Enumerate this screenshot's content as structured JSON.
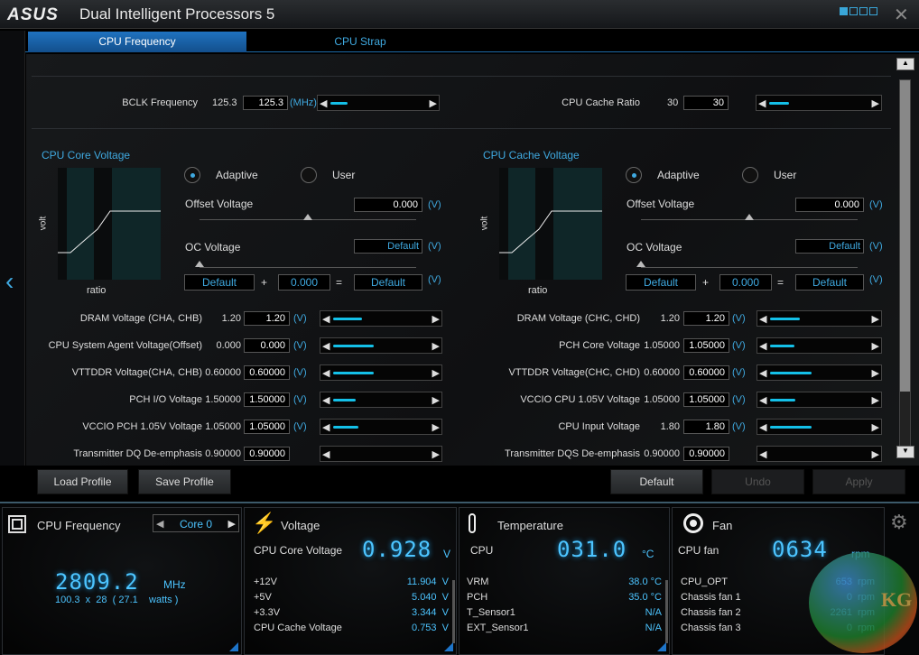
{
  "window": {
    "logo": "ASUS",
    "title": "Dual Intelligent Processors 5",
    "close": "✕"
  },
  "tabs": [
    {
      "label": "CPU Frequency",
      "active": true
    },
    {
      "label": "CPU Strap",
      "active": false
    }
  ],
  "top_row": {
    "bclk": {
      "label": "BCLK Frequency",
      "default": "125.3",
      "value": "125.3",
      "unit": "(MHz)",
      "fill": 0.18
    },
    "cache_ratio": {
      "label": "CPU Cache Ratio",
      "default": "30",
      "value": "30",
      "fill": 0.2
    }
  },
  "core_voltage": {
    "title": "CPU Core Voltage",
    "mode_adaptive": "Adaptive",
    "mode_user": "User",
    "selected": "Adaptive",
    "offset_label": "Offset Voltage",
    "offset_value": "0.000",
    "unit": "(V)",
    "oc_label": "OC Voltage",
    "oc_value": "Default",
    "sum_a": "Default",
    "plus": "+",
    "sum_b": "0.000",
    "equals": "=",
    "sum_result": "Default",
    "graph_ylabel": "volt",
    "graph_xlabel": "ratio",
    "offset_slider": 0.5,
    "oc_slider": 0.0
  },
  "cache_voltage": {
    "title": "CPU Cache Voltage",
    "mode_adaptive": "Adaptive",
    "mode_user": "User",
    "selected": "Adaptive",
    "offset_label": "Offset Voltage",
    "offset_value": "0.000",
    "unit": "(V)",
    "oc_label": "OC Voltage",
    "oc_value": "Default",
    "sum_a": "Default",
    "plus": "+",
    "sum_b": "0.000",
    "equals": "=",
    "sum_result": "Default",
    "graph_ylabel": "volt",
    "graph_xlabel": "ratio",
    "offset_slider": 0.5,
    "oc_slider": 0.0
  },
  "left_rows": [
    {
      "label": "DRAM Voltage (CHA, CHB)",
      "default": "1.20",
      "value": "1.20",
      "unit": "(V)",
      "fill": 0.3
    },
    {
      "label": "CPU System Agent Voltage(Offset)",
      "default": "0.000",
      "value": "0.000",
      "unit": "(V)",
      "fill": 0.42
    },
    {
      "label": "VTTDDR Voltage(CHA, CHB)",
      "default": "0.60000",
      "value": "0.60000",
      "unit": "(V)",
      "fill": 0.42
    },
    {
      "label": "PCH I/O Voltage",
      "default": "1.50000",
      "value": "1.50000",
      "unit": "(V)",
      "fill": 0.24
    },
    {
      "label": "VCCIO PCH 1.05V Voltage",
      "default": "1.05000",
      "value": "1.05000",
      "unit": "(V)",
      "fill": 0.26
    },
    {
      "label": "Transmitter DQ De-emphasis",
      "default": "0.90000",
      "value": "0.90000",
      "unit": "",
      "fill": 0
    }
  ],
  "right_rows": [
    {
      "label": "DRAM Voltage (CHC, CHD)",
      "default": "1.20",
      "value": "1.20",
      "unit": "(V)",
      "fill": 0.3
    },
    {
      "label": "PCH Core Voltage",
      "default": "1.05000",
      "value": "1.05000",
      "unit": "(V)",
      "fill": 0.25
    },
    {
      "label": "VTTDDR Voltage(CHC, CHD)",
      "default": "0.60000",
      "value": "0.60000",
      "unit": "(V)",
      "fill": 0.42
    },
    {
      "label": "VCCIO CPU 1.05V Voltage",
      "default": "1.05000",
      "value": "1.05000",
      "unit": "(V)",
      "fill": 0.26
    },
    {
      "label": "CPU Input Voltage",
      "default": "1.80",
      "value": "1.80",
      "unit": "(V)",
      "fill": 0.42
    },
    {
      "label": "Transmitter DQS De-emphasis",
      "default": "0.90000",
      "value": "0.90000",
      "unit": "",
      "fill": 0
    }
  ],
  "buttons": {
    "load": "Load Profile",
    "save": "Save Profile",
    "default": "Default",
    "undo": "Undo",
    "apply": "Apply"
  },
  "monitor": {
    "cpu_freq": {
      "title": "CPU Frequency",
      "core_select": "Core 0",
      "value": "2809.2",
      "unit": "MHz",
      "bclk": "100.3",
      "x": "x",
      "ratio": "28",
      "watts": "( 27.1    watts )"
    },
    "voltage": {
      "title": "Voltage",
      "main_label": "CPU Core Voltage",
      "main_value": "0.928",
      "main_unit": "V",
      "rows": [
        {
          "label": "+12V",
          "value": "11.904  V"
        },
        {
          "label": "+5V",
          "value": "5.040  V"
        },
        {
          "label": "+3.3V",
          "value": "3.344  V"
        },
        {
          "label": "CPU Cache Voltage",
          "value": "0.753  V"
        }
      ]
    },
    "temperature": {
      "title": "Temperature",
      "main_label": "CPU",
      "main_value": "031.0",
      "main_unit": "°C",
      "rows": [
        {
          "label": "VRM",
          "value": "38.0 °C"
        },
        {
          "label": "PCH",
          "value": "35.0 °C"
        },
        {
          "label": "T_Sensor1",
          "value": "N/A"
        },
        {
          "label": "EXT_Sensor1",
          "value": "N/A"
        }
      ]
    },
    "fan": {
      "title": "Fan",
      "main_label": "CPU fan",
      "main_value": "0634",
      "main_unit": "rpm",
      "rows": [
        {
          "label": "CPU_OPT",
          "value": "653  rpm"
        },
        {
          "label": "Chassis fan 1",
          "value": "0  rpm"
        },
        {
          "label": "Chassis fan 2",
          "value": "2261  rpm"
        },
        {
          "label": "Chassis fan 3",
          "value": "0  rpm"
        }
      ]
    }
  },
  "watermark": "KG",
  "colors": {
    "accent": "#3fa9e0",
    "fill": "#14c0e8",
    "tab_active": "#1f72bf"
  }
}
